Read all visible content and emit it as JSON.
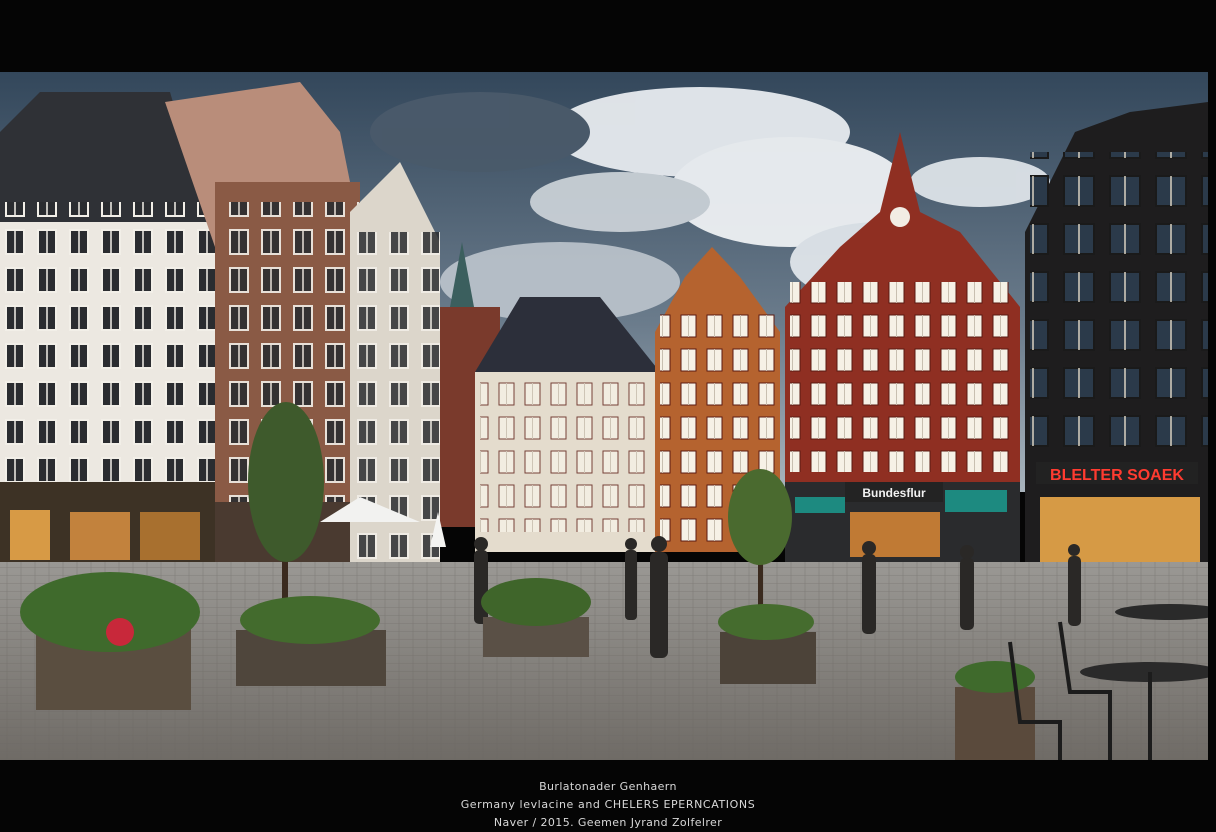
{
  "photo": {
    "description_alt": "",
    "signs": {
      "left_shop": "",
      "center_shop": "Bundesflur",
      "right_shop": "BLELTER SOAEK"
    },
    "colors": {
      "sky_top": "#2f4255",
      "cloud": "#e9eef3",
      "red_facade": "#8c2f22",
      "orange_facade": "#b5632f",
      "white_facade": "#e8e3da",
      "pavement": "#8c8c89",
      "neon_red": "#e8262a"
    }
  },
  "caption": {
    "line1": "Burlatonader Genhaern",
    "line2": "Germany levlacine and CHELERS EPERNCATIONS",
    "line3": "Naver / 2015. Geemen Jyrand Zolfelrer"
  }
}
